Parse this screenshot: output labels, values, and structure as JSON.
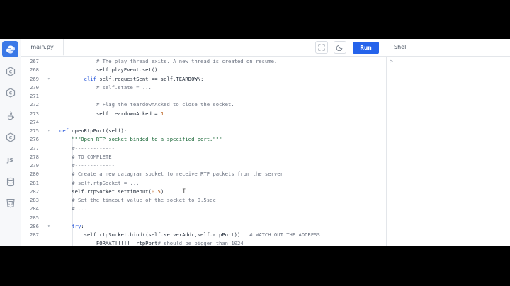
{
  "rail": {
    "items": [
      {
        "name": "python-logo-icon",
        "label": ""
      },
      {
        "name": "c-icon",
        "label": "C"
      },
      {
        "name": "cpp-icon",
        "label": "C"
      },
      {
        "name": "java-icon",
        "label": ""
      },
      {
        "name": "csharp-icon",
        "label": "C"
      },
      {
        "name": "javascript-icon",
        "label": "JS"
      },
      {
        "name": "database-icon",
        "label": ""
      },
      {
        "name": "html-icon",
        "label": ""
      }
    ],
    "accent": "#3a78e7"
  },
  "topbar": {
    "tab_label": "main.py",
    "fullscreen_icon": "fullscreen-icon",
    "theme_icon": "moon-icon",
    "run_label": "Run",
    "run_color": "#2563eb"
  },
  "shell": {
    "title": "Shell",
    "prompt": ">"
  },
  "editor": {
    "lines": [
      {
        "n": "267",
        "fold": "",
        "code": "            # The play thread exits. A new thread is created on resume."
      },
      {
        "n": "268",
        "fold": "",
        "code": "            self.playEvent.set()"
      },
      {
        "n": "269",
        "fold": "▾",
        "code": "        elif self.requestSent == self.TEARDOWN:"
      },
      {
        "n": "270",
        "fold": "",
        "code": "            # self.state = ..."
      },
      {
        "n": "271",
        "fold": "",
        "code": ""
      },
      {
        "n": "272",
        "fold": "",
        "code": "            # Flag the teardownAcked to close the socket."
      },
      {
        "n": "273",
        "fold": "",
        "code": "            self.teardownAcked = 1"
      },
      {
        "n": "274",
        "fold": "",
        "code": ""
      },
      {
        "n": "275",
        "fold": "▾",
        "code": "def openRtpPort(self):"
      },
      {
        "n": "276",
        "fold": "",
        "code": "    \"\"\"Open RTP socket binded to a specified port.\"\"\""
      },
      {
        "n": "277",
        "fold": "",
        "code": "    #-------------"
      },
      {
        "n": "278",
        "fold": "",
        "code": "    # TO COMPLETE"
      },
      {
        "n": "279",
        "fold": "",
        "code": "    #-------------"
      },
      {
        "n": "280",
        "fold": "",
        "code": "    # Create a new datagram socket to receive RTP packets from the server"
      },
      {
        "n": "281",
        "fold": "",
        "code": "    # self.rtpSocket = ..."
      },
      {
        "n": "282",
        "fold": "",
        "code": "    self.rtpSocket.settimeout(0.5)"
      },
      {
        "n": "283",
        "fold": "",
        "code": "    # Set the timeout value of the socket to 0.5sec"
      },
      {
        "n": "284",
        "fold": "",
        "code": "    # ..."
      },
      {
        "n": "285",
        "fold": "",
        "code": ""
      },
      {
        "n": "286",
        "fold": "▾",
        "code": "    try:"
      },
      {
        "n": "287",
        "fold": "",
        "code": "        self.rtpSocket.bind((self.serverAddr,self.rtpPort))   # WATCH OUT THE ADDRESS"
      },
      {
        "n": "",
        "fold": "",
        "code": "            FORMAT!!!!!  rtpPort# should be bigger than 1024"
      }
    ]
  }
}
